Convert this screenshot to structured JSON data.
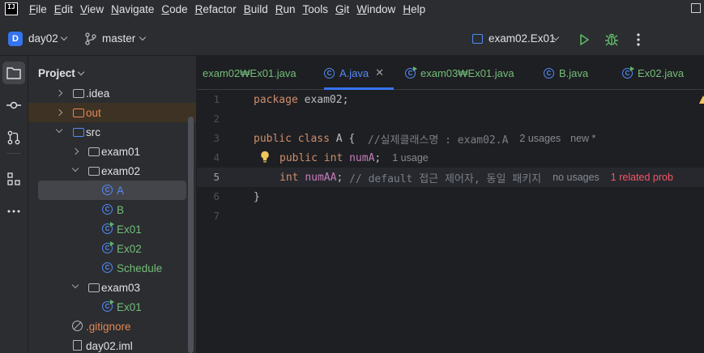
{
  "menubar": {
    "items": [
      {
        "label": "File",
        "mn": "F",
        "rest": "ile"
      },
      {
        "label": "Edit",
        "mn": "E",
        "rest": "dit"
      },
      {
        "label": "View",
        "mn": "V",
        "rest": "iew"
      },
      {
        "label": "Navigate",
        "mn": "N",
        "rest": "avigate"
      },
      {
        "label": "Code",
        "mn": "C",
        "rest": "ode"
      },
      {
        "label": "Refactor",
        "mn": "R",
        "rest": "efactor"
      },
      {
        "label": "Build",
        "mn": "B",
        "rest": "uild"
      },
      {
        "label": "Run",
        "mn": "R",
        "rest": "un"
      },
      {
        "label": "Tools",
        "mn": "T",
        "rest": "ools"
      },
      {
        "label": "Git",
        "mn": "G",
        "rest": "it"
      },
      {
        "label": "Window",
        "mn": "W",
        "rest": "indow"
      },
      {
        "label": "Help",
        "mn": "H",
        "rest": "elp"
      }
    ]
  },
  "toolbar": {
    "project_badge": "D",
    "project_name": "day02",
    "branch": "master",
    "run_config": "exam02.Ex01"
  },
  "project_panel": {
    "title": "Project",
    "tree": {
      "idea": ".idea",
      "out": "out",
      "src": "src",
      "exam01": "exam01",
      "exam02": "exam02",
      "class_A": "A",
      "class_B": "B",
      "class_Ex01": "Ex01",
      "class_Ex02": "Ex02",
      "class_Schedule": "Schedule",
      "exam03": "exam03",
      "exam03_Ex01": "Ex01",
      "gitignore": ".gitignore",
      "iml": "day02.iml"
    }
  },
  "tabs": [
    {
      "label": "exam02₩Ex01.java"
    },
    {
      "label": "A.java"
    },
    {
      "label": "exam03₩Ex01.java"
    },
    {
      "label": "B.java"
    },
    {
      "label": "Ex02.java"
    }
  ],
  "editor": {
    "line_numbers": [
      "1",
      "2",
      "3",
      "4",
      "5",
      "6",
      "7"
    ],
    "line1": {
      "kw": "package",
      "rest": " exam02;"
    },
    "line3": {
      "kw1": "public",
      "kw2": "class",
      "rest": " A {  ",
      "comment": "//실제클래스명 : exam02.A",
      "usages": "2 usages",
      "new": "new *"
    },
    "line4": {
      "kw1": "public",
      "kw2": "int",
      "field": "numA",
      "semi": ";",
      "usages": "1 usage"
    },
    "line5": {
      "kw": "int",
      "field": "numAA",
      "semi": "; ",
      "comment": "// default 접근 제어자, 동일 패키지",
      "usages": "no usages",
      "problem": "1 related prob"
    },
    "line6": "}"
  }
}
